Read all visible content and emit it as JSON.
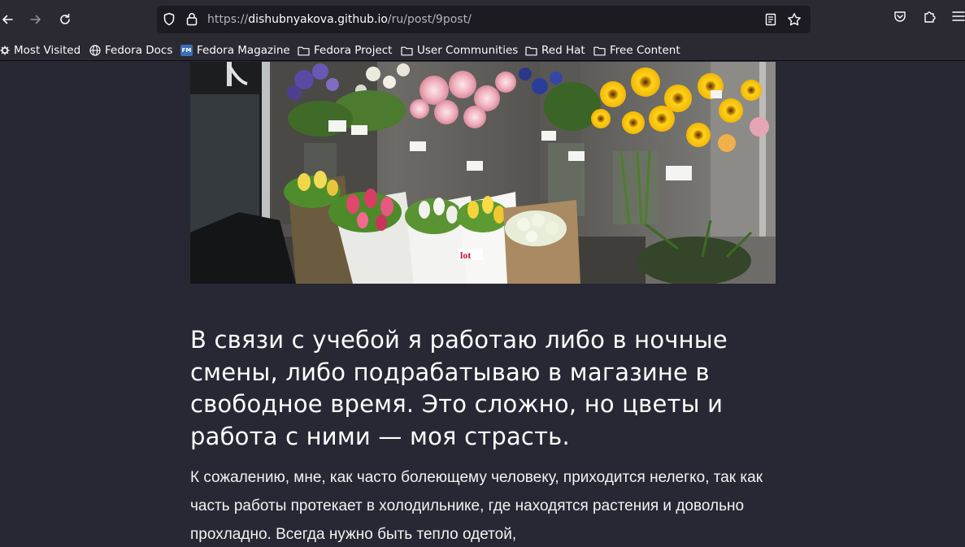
{
  "browser": {
    "url": {
      "prefix": "https://",
      "host": "dishubnyakova.github.io",
      "path": "/ru/post/9post/"
    },
    "bookmarks": [
      {
        "label": "Most Visited",
        "icon": "gear-icon"
      },
      {
        "label": "Fedora Docs",
        "icon": "globe-icon"
      },
      {
        "label": "Fedora Magazine",
        "icon": "fedora-magazine-icon"
      },
      {
        "label": "Fedora Project",
        "icon": "folder-icon"
      },
      {
        "label": "User Communities",
        "icon": "folder-icon"
      },
      {
        "label": "Red Hat",
        "icon": "folder-icon"
      },
      {
        "label": "Free Content",
        "icon": "folder-icon"
      }
    ],
    "fm_badge": "FM"
  },
  "article": {
    "heading": "В связи с учебой я работаю либо в ночные смены, либо подрабатываю в магазине в свободное время. Это сложно, но цветы и работа с ними — моя страсть.",
    "paragraph": "К сожалению, мне, как часто болеющему человеку, приходится нелегко, так как часть работы протекает в холодильнике, где находятся растения и довольно прохладно. Всегда нужно быть тепло одетой,"
  },
  "colors": {
    "page_background": "#272834",
    "toolbar_background": "#2b2a33",
    "urlbar_background": "#1c1b22",
    "text": "#ffffff"
  }
}
